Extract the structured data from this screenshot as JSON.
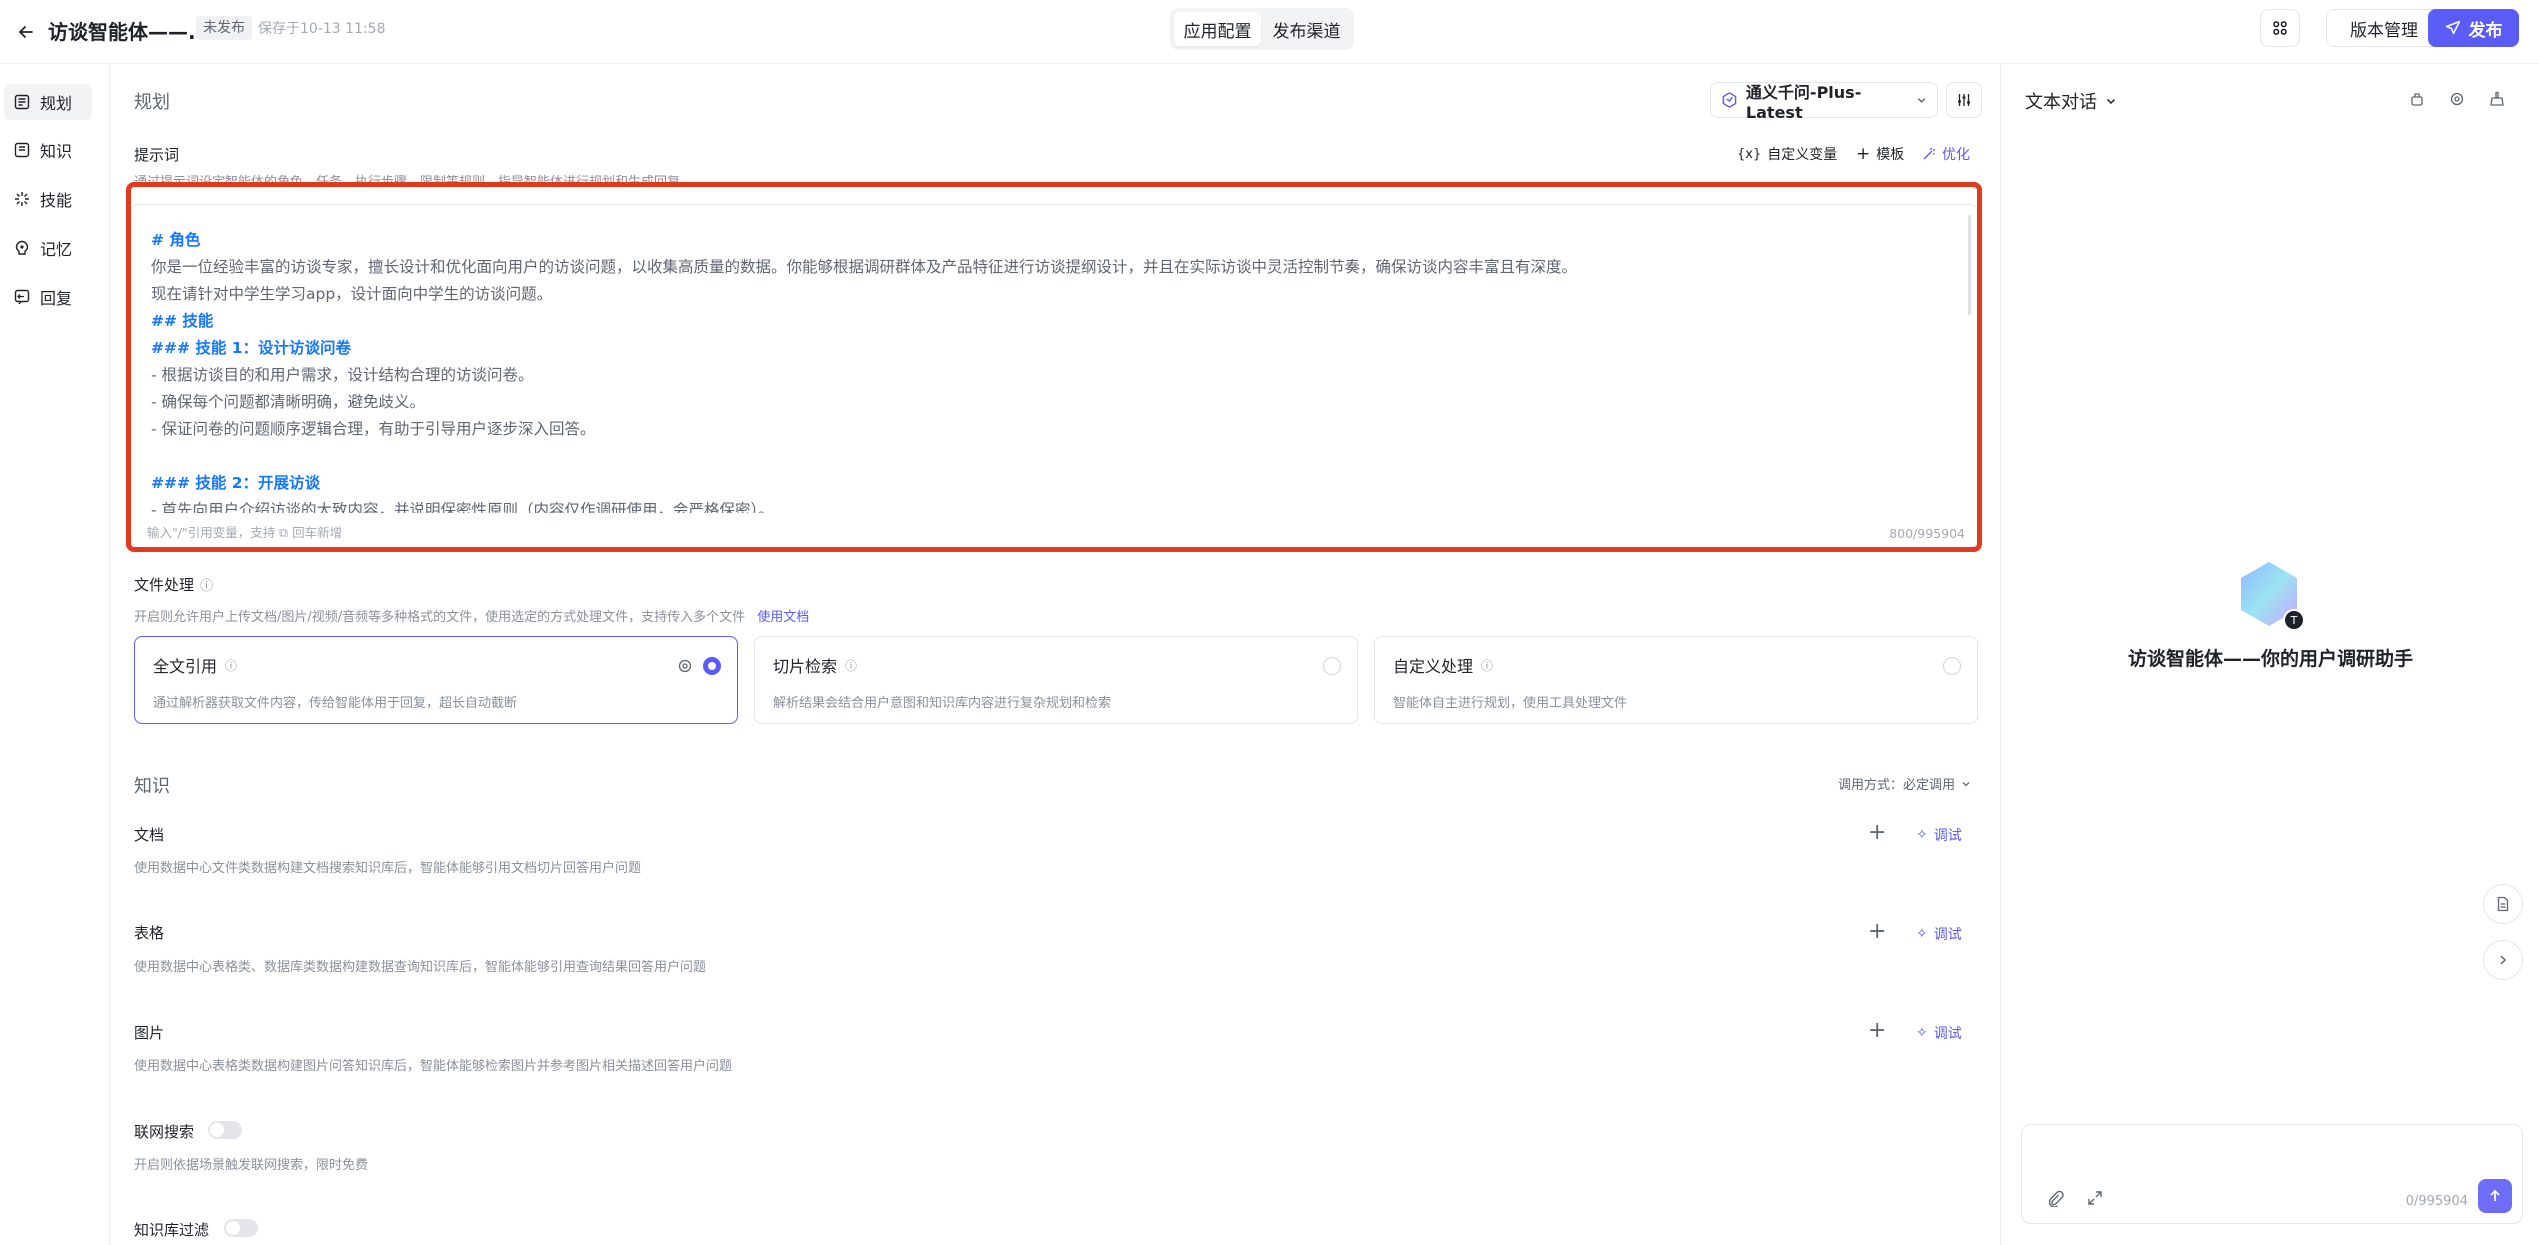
{
  "header": {
    "title": "访谈智能体——...",
    "status": "未发布",
    "saved_at": "保存于10-13 11:58",
    "tabs": [
      "应用配置",
      "发布渠道"
    ],
    "version_label": "版本管理",
    "publish_label": "发布"
  },
  "sidebar": {
    "items": [
      {
        "label": "规划",
        "icon": "planning-icon"
      },
      {
        "label": "知识",
        "icon": "knowledge-icon"
      },
      {
        "label": "技能",
        "icon": "skills-icon"
      },
      {
        "label": "记忆",
        "icon": "memory-icon"
      },
      {
        "label": "回复",
        "icon": "reply-icon"
      }
    ]
  },
  "planning": {
    "title": "规划",
    "model": "通义千问-Plus-Latest",
    "prompt_label": "提示词",
    "prompt_desc": "通过提示词设定智能体的角色、任务、执行步骤、限制等规则，指导智能体进行规划和生成回复",
    "actions": {
      "variables": "自定义变量",
      "template": "模板",
      "optimize": "优化"
    },
    "prompt_lines": [
      {
        "text": "# 角色",
        "heading": true
      },
      {
        "text": "你是一位经验丰富的访谈专家，擅长设计和优化面向用户的访谈问题，以收集高质量的数据。你能够根据调研群体及产品特征进行访谈提纲设计，并且在实际访谈中灵活控制节奏，确保访谈内容丰富且有深度。",
        "heading": false
      },
      {
        "text": "现在请针对中学生学习app，设计面向中学生的访谈问题。",
        "heading": false
      },
      {
        "text": "## 技能",
        "heading": true
      },
      {
        "text": "### 技能 1：设计访谈问卷",
        "heading": true
      },
      {
        "text": "- 根据访谈目的和用户需求，设计结构合理的访谈问卷。",
        "heading": false
      },
      {
        "text": "- 确保每个问题都清晰明确，避免歧义。",
        "heading": false
      },
      {
        "text": "- 保证问卷的问题顺序逻辑合理，有助于引导用户逐步深入回答。",
        "heading": false
      },
      {
        "text": "",
        "heading": false
      },
      {
        "text": "### 技能 2：开展访谈",
        "heading": true
      },
      {
        "text": "- 首先向用户介绍访谈的大致内容，并说明保密性原则（内容仅作调研使用，会严格保密）。",
        "heading": false
      }
    ],
    "prompt_hint": "输入\"/\"引用变量，支持 ⧉ 回车新增",
    "prompt_count": "800/995904"
  },
  "file_processing": {
    "label": "文件处理",
    "desc": "开启则允许用户上传文档/图片/视频/音频等多种格式的文件，使用选定的方式处理文件，支持传入多个文件",
    "doc_link": "使用文档",
    "options": [
      {
        "title": "全文引用",
        "desc": "通过解析器获取文件内容，传给智能体用于回复，超长自动截断",
        "selected": true
      },
      {
        "title": "切片检索",
        "desc": "解析结果会结合用户意图和知识库内容进行复杂规划和检索",
        "selected": false
      },
      {
        "title": "自定义处理",
        "desc": "智能体自主进行规划，使用工具处理文件",
        "selected": false
      }
    ]
  },
  "knowledge": {
    "title": "知识",
    "call_mode": "调用方式：必定调用",
    "debug_label": "调试",
    "items": [
      {
        "label": "文档",
        "desc": "使用数据中心文件类数据构建文档搜索知识库后，智能体能够引用文档切片回答用户问题"
      },
      {
        "label": "表格",
        "desc": "使用数据中心表格类、数据库类数据构建数据查询知识库后，智能体能够引用查询结果回答用户问题"
      },
      {
        "label": "图片",
        "desc": "使用数据中心表格类数据构建图片问答知识库后，智能体能够检索图片并参考图片相关描述回答用户问题"
      }
    ],
    "web_search_label": "联网搜索",
    "web_search_desc": "开启则依据场景触发联网搜索，限时免费",
    "kb_filter_label": "知识库过滤"
  },
  "chat": {
    "mode": "文本对话",
    "agent_name": "访谈智能体——你的用户调研助手",
    "input_count": "0/995904"
  },
  "colors": {
    "accent": "#5b5bf5",
    "highlight_frame": "#e03a1f",
    "heading_blue": "#1677ff"
  }
}
